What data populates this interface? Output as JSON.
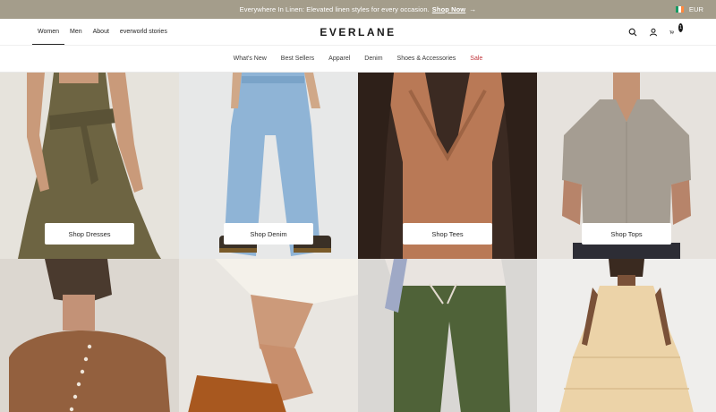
{
  "announcement": {
    "text": "Everywhere In Linen: Elevated linen styles for every occasion.",
    "link": "Shop Now",
    "currency": "EUR"
  },
  "header": {
    "gender_nav": [
      "Women",
      "Men",
      "About",
      "everworld stories"
    ],
    "active": "Women",
    "logo": "EVERLANE",
    "cart_count": "1"
  },
  "categories": [
    "What's New",
    "Best Sellers",
    "Apparel",
    "Denim",
    "Shoes & Accessories",
    "Sale"
  ],
  "tiles": [
    {
      "button": "Shop Dresses"
    },
    {
      "button": "Shop Denim"
    },
    {
      "button": "Shop Tees"
    },
    {
      "button": "Shop Tops"
    }
  ],
  "colors": {
    "announce_bg": "#a49d8b",
    "sale": "#c1363c"
  }
}
